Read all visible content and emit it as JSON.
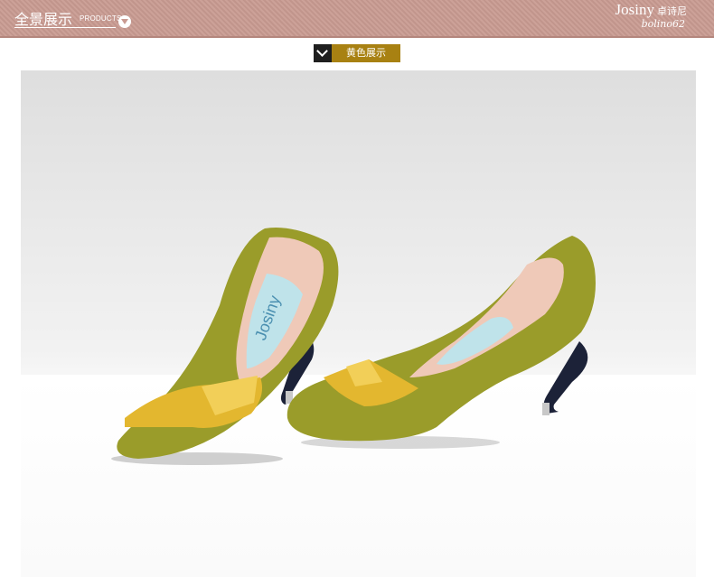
{
  "header": {
    "title": "全景展示",
    "subtitle": "PRODUCTS",
    "brand": "Josiny",
    "brand_cn": "卓诗尼",
    "brand_signature": "bolino62"
  },
  "section": {
    "label": "黄色展示"
  },
  "product": {
    "color_name": "yellow",
    "insole_print": "Josiny",
    "colors": {
      "suede": "#9a9c2a",
      "bow": "#e3b72f",
      "lining": "#efc9b8",
      "heel": "#1c2238",
      "header": "#c99b92",
      "tag": "#a88112"
    }
  }
}
